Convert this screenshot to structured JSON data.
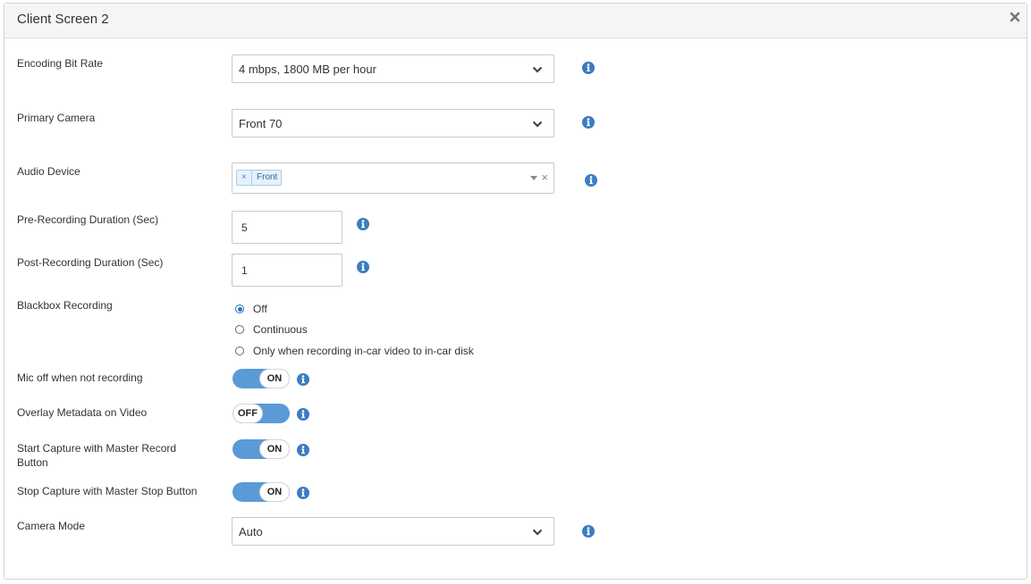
{
  "dialog": {
    "title": "Client Screen 2"
  },
  "fields": {
    "encoding_bit_rate": {
      "label": "Encoding Bit Rate",
      "value": "4 mbps, 1800 MB per hour"
    },
    "primary_camera": {
      "label": "Primary Camera",
      "value": "Front 70"
    },
    "audio_device": {
      "label": "Audio Device",
      "tags": [
        "Front"
      ],
      "remove_glyph": "×",
      "clear_glyph": "×"
    },
    "pre_recording": {
      "label": "Pre-Recording Duration (Sec)",
      "value": "5"
    },
    "post_recording": {
      "label": "Post-Recording Duration (Sec)",
      "value": "1"
    },
    "blackbox_recording": {
      "label": "Blackbox Recording",
      "options": [
        "Off",
        "Continuous",
        "Only when recording in-car video to in-car disk"
      ],
      "selected": "Off"
    },
    "mic_off": {
      "label": "Mic off when not recording",
      "state": "ON"
    },
    "overlay_metadata": {
      "label": "Overlay Metadata on Video",
      "state": "OFF"
    },
    "start_capture": {
      "label": "Start Capture with Master Record Button",
      "state": "ON"
    },
    "stop_capture": {
      "label": "Stop Capture with Master Stop Button",
      "state": "ON"
    },
    "camera_mode": {
      "label": "Camera Mode",
      "value": "Auto"
    }
  },
  "icons": {
    "info": "info-icon",
    "close": "close-icon",
    "chevron": "chevron-down-icon"
  },
  "colors": {
    "accent": "#5a9ad6",
    "info_icon": "#3b7cc1",
    "radio_selected": "#2a6fc9"
  }
}
